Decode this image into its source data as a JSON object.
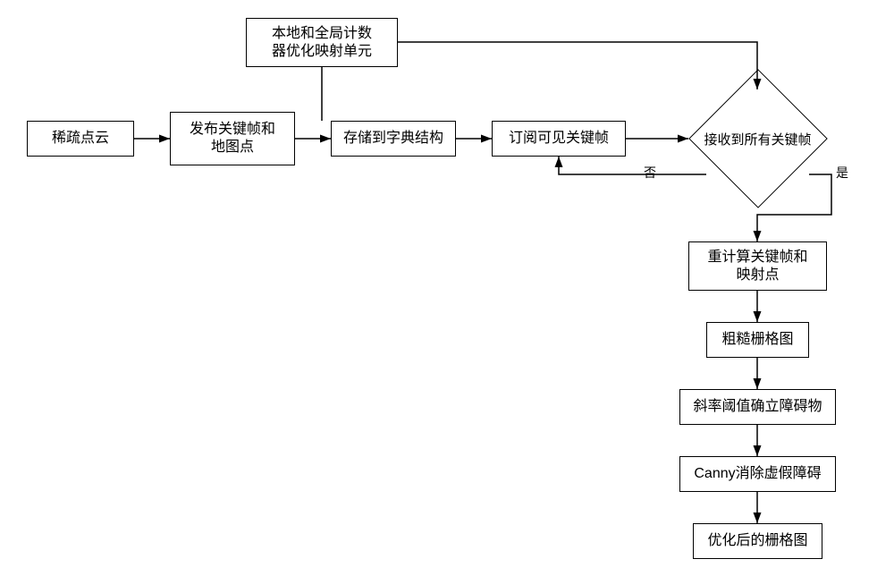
{
  "nodes": {
    "sparse_pc": "稀疏点云",
    "publish_kf": "发布关键帧和\n地图点",
    "counter_unit": "本地和全局计数\n器优化映射单元",
    "store_dict": "存储到字典结构",
    "subscribe_kf": "订阅可见关键帧",
    "recv_all_kf": "接收到所有关键帧",
    "recompute": "重计算关键帧和\n映射点",
    "rough_grid": "粗糙栅格图",
    "slope_obs": "斜率阈值确立障碍物",
    "canny": "Canny消除虚假障碍",
    "opt_grid": "优化后的栅格图"
  },
  "labels": {
    "no": "否",
    "yes": "是"
  }
}
